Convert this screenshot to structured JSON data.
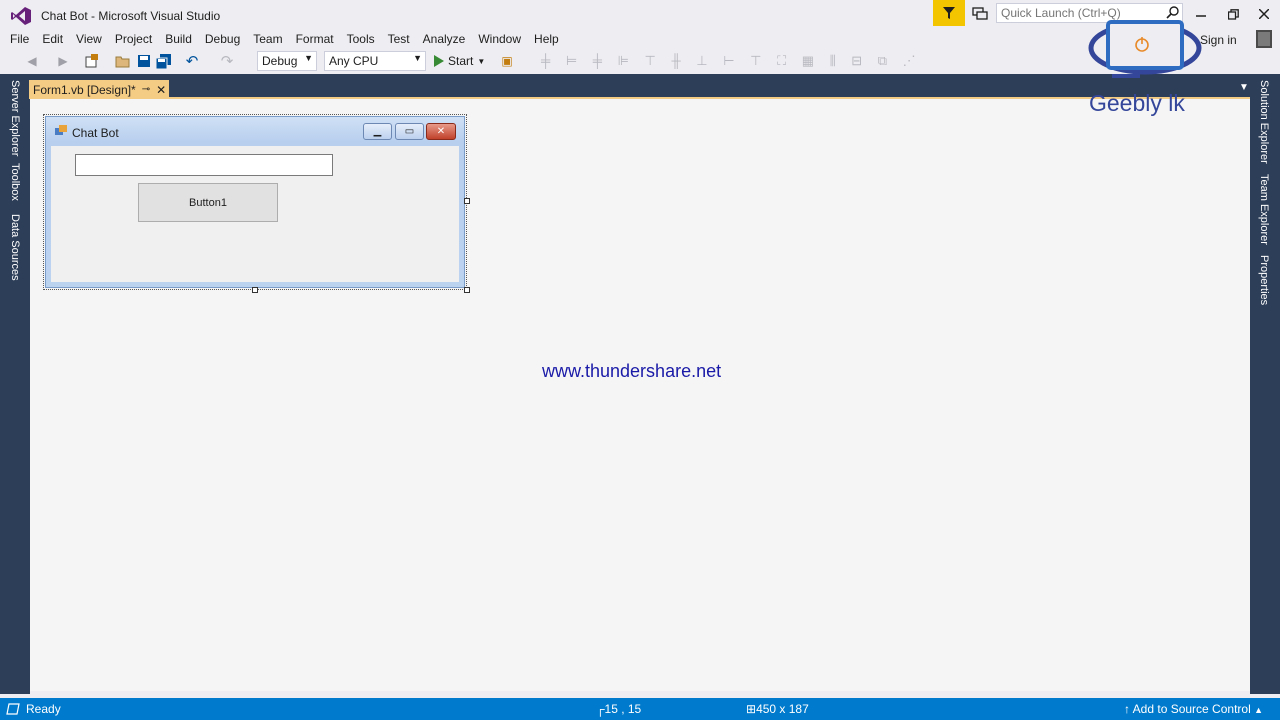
{
  "window": {
    "title": "Chat Bot - Microsoft Visual Studio",
    "quick_launch_placeholder": "Quick Launch (Ctrl+Q)",
    "signin": "Sign in"
  },
  "menu": [
    "File",
    "Edit",
    "View",
    "Project",
    "Build",
    "Debug",
    "Team",
    "Format",
    "Tools",
    "Test",
    "Analyze",
    "Window",
    "Help"
  ],
  "toolbar": {
    "config": "Debug",
    "platform": "Any CPU",
    "start": "Start"
  },
  "left_tabs": [
    "Server Explorer",
    "Toolbox",
    "Data Sources"
  ],
  "right_tabs": [
    "Solution Explorer",
    "Team Explorer",
    "Properties"
  ],
  "document_tab": {
    "label": "Form1.vb [Design]*"
  },
  "form": {
    "title": "Chat Bot",
    "button_text": "Button1",
    "textbox_value": ""
  },
  "watermark": {
    "url": "www.thundershare.net",
    "brand": "Geebly lk"
  },
  "status": {
    "text": "Ready",
    "position": "15 , 15",
    "size": "450 x 187",
    "source_control": "Add to Source Control"
  },
  "colors": {
    "accent": "#007acc",
    "frame": "#2d3e58",
    "tab_active": "#f5cc84",
    "filter": "#f2c500"
  }
}
